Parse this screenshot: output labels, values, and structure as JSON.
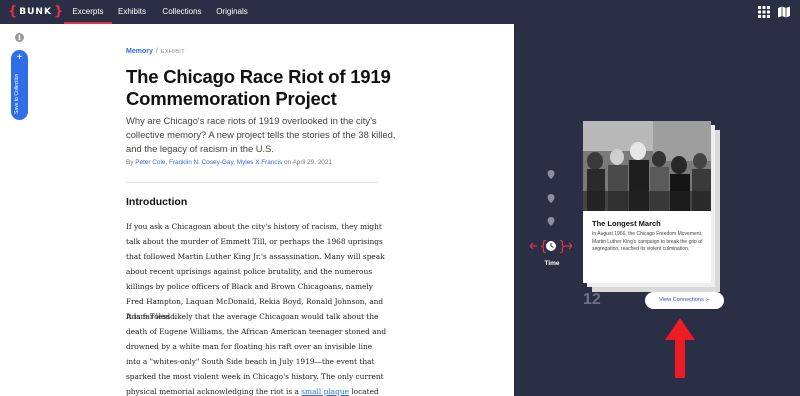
{
  "colors": {
    "nav_bg": "#2b2f45",
    "accent_red": "#e0334b",
    "link_blue": "#2f6ee6"
  },
  "nav": {
    "logo_text": "BUNK",
    "tabs": [
      "Excerpts",
      "Exhibits",
      "Collections",
      "Originals"
    ],
    "active_tab": "Excerpts",
    "icons": [
      "grid-icon",
      "map-icon"
    ]
  },
  "rail": {
    "save_label": "Save to Collection"
  },
  "article": {
    "breadcrumb_link": "Memory",
    "breadcrumb_sep": "/",
    "breadcrumb_type": "EXHIBIT",
    "title": "The Chicago Race Riot of 1919 Commemoration Project",
    "dek": "Why are Chicago's race riots of 1919 overlooked in the city's collective memory? A new project tells the stories of the 38 killed, and the legacy of racism in the U.S.",
    "byline_prefix": "By",
    "authors": [
      "Peter Cole",
      "Franklin N. Cosey-Gay",
      "Myles X Francis"
    ],
    "authors_sep": ",",
    "authors_join": "and",
    "byline_date_prefix": "on",
    "date": "April 29, 2021",
    "section_heading": "Introduction",
    "paragraph1": "If you ask a Chicagoan about the city's history of racism, they might talk about the murder of Emmett Till, or perhaps the 1968 uprisings that followed Martin Luther King Jr.'s assassination. Many will speak about recent uprisings against police brutality, and the numerous killings by police officers of Black and Brown Chicagoans, namely Fred Hampton, Laquan McDonald, Rekia Boyd, Ronald Johnson, and Adam Toledo.",
    "paragraph2": "It is far less likely that the average Chicagoan would talk about the death of Eugene Williams, the African American teenager stoned and drowned by a white man for floating his raft over an invisible line into a \"whites-only\" South Side beach in July 1919—the event that sparked the most violent week in Chicago's history. The only current physical memorial acknowledging the riot is a",
    "paragraph2_link": "small plaque",
    "paragraph2_tail": "located near the"
  },
  "panel": {
    "filter_label": "Time",
    "count": "12",
    "card": {
      "title": "The Longest March",
      "text": "In August 1966, the Chicago Freedom Movement, Martin Luther King's campaign to break the grip of segregation, reached its violent culmination."
    },
    "view_button": "View Connections",
    "view_button_icon": "⟜"
  }
}
